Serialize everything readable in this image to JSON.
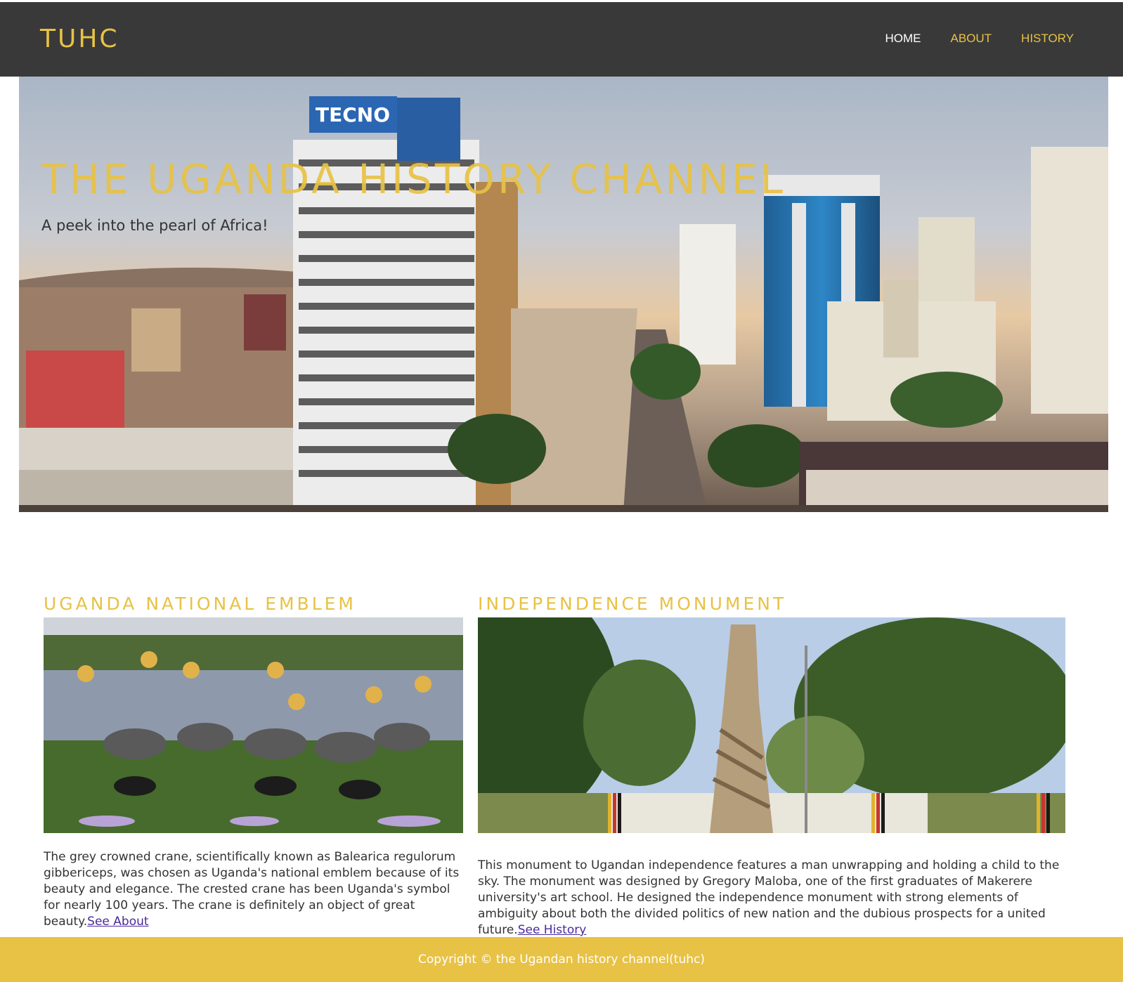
{
  "nav": {
    "brand": "TUHC",
    "links": [
      {
        "label": "HOME"
      },
      {
        "label": "ABOUT"
      },
      {
        "label": "HISTORY"
      }
    ]
  },
  "hero": {
    "title": "THE UGANDA HISTORY CHANNEL",
    "subtitle": "A peek into the pearl of Africa!",
    "sign_text": "TECNO"
  },
  "cards": [
    {
      "title": "UGANDA NATIONAL EMBLEM",
      "text": "The grey crowned crane, scientifically known as Balearica regulorum gibbericeps, was chosen as Uganda's national emblem because of its beauty and elegance. The crested crane has been Uganda's symbol for nearly 100 years. The crane is definitely an object of great beauty.",
      "link": "See About"
    },
    {
      "title": "INDEPENDENCE MONUMENT",
      "text": "This monument to Ugandan independence features a man unwrapping and holding a child to the sky. The monument was designed by Gregory Maloba, one of the first graduates of Makerere university's art school. He designed the independence monument with strong elements of ambiguity about both the divided politics of new nation and the dubious prospects for a united future.",
      "link": "See History"
    }
  ],
  "footer": {
    "text": "Copyright © the Ugandan history channel(tuhc)"
  },
  "colors": {
    "accent": "#e8c245",
    "nav_bg": "#393939",
    "link": "#4b2a9b"
  }
}
